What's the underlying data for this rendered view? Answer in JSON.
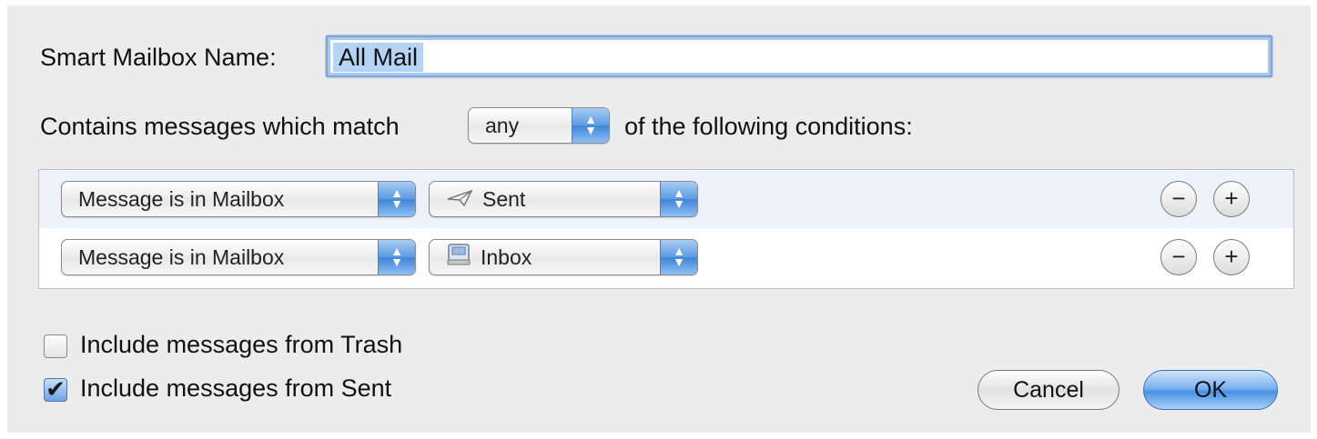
{
  "dialog": {
    "name_label": "Smart Mailbox Name:",
    "name_value": "All Mail",
    "match_prefix": "Contains messages which match",
    "match_value": "any",
    "match_suffix": "of the following conditions:"
  },
  "conditions": [
    {
      "field": "Message is in Mailbox",
      "mailbox": "Sent",
      "mailbox_icon": "sent-icon",
      "remove": "−",
      "add": "+"
    },
    {
      "field": "Message is in Mailbox",
      "mailbox": "Inbox",
      "mailbox_icon": "inbox-icon",
      "remove": "−",
      "add": "+"
    }
  ],
  "options": {
    "trash_label": "Include messages from Trash",
    "trash_checked": false,
    "sent_label": "Include messages from Sent",
    "sent_checked": true
  },
  "buttons": {
    "cancel": "Cancel",
    "ok": "OK"
  },
  "colors": {
    "accent": "#5b9be3",
    "selection": "#b5d3f5"
  }
}
